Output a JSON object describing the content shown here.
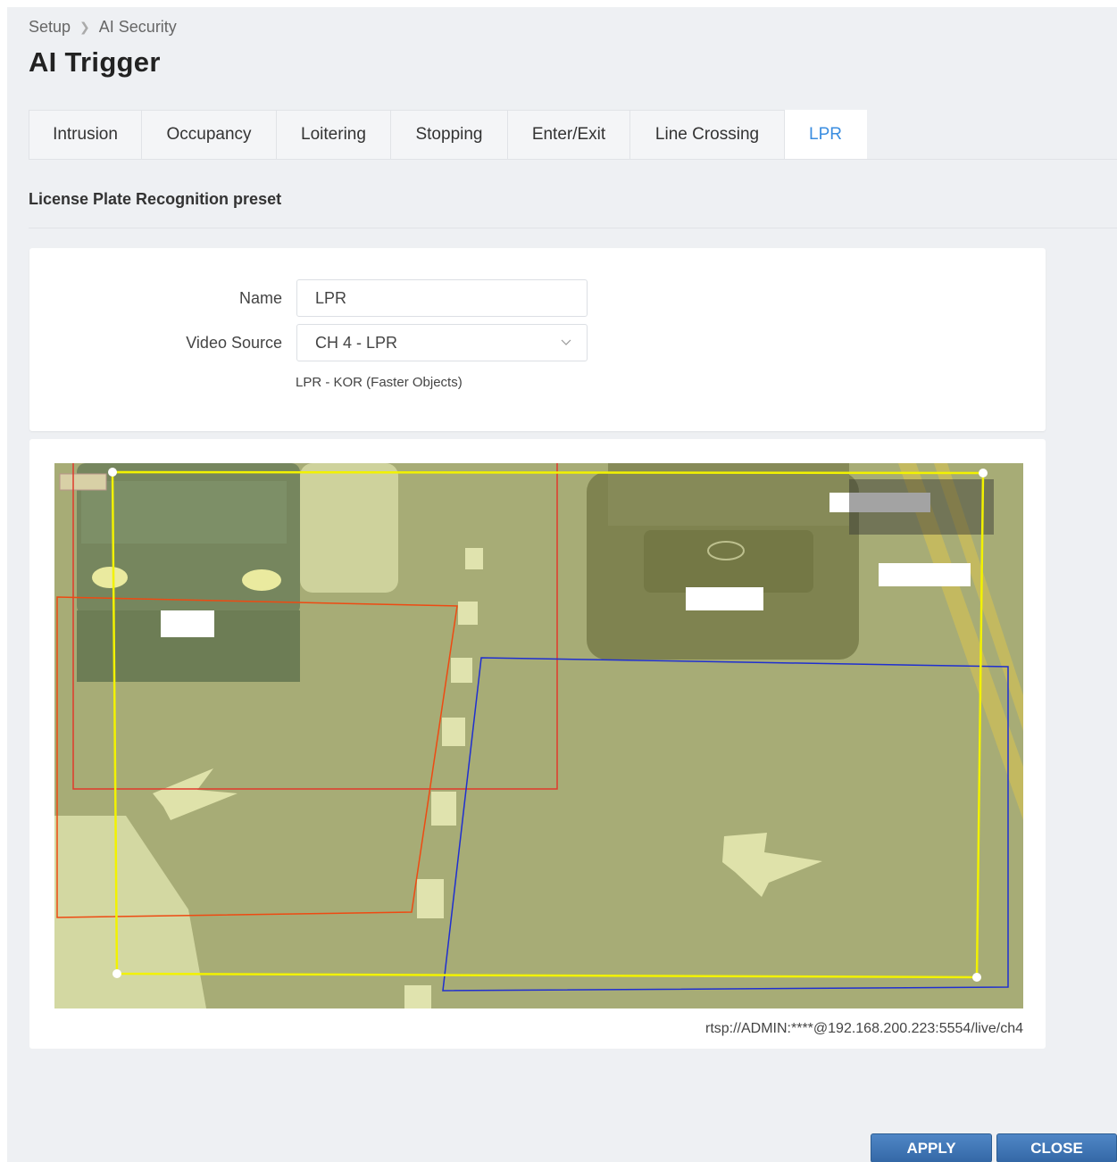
{
  "breadcrumb": {
    "root": "Setup",
    "current": "AI Security"
  },
  "page": {
    "title": "AI Trigger"
  },
  "tabs": [
    {
      "label": "Intrusion",
      "active": false
    },
    {
      "label": "Occupancy",
      "active": false
    },
    {
      "label": "Loitering",
      "active": false
    },
    {
      "label": "Stopping",
      "active": false
    },
    {
      "label": "Enter/Exit",
      "active": false
    },
    {
      "label": "Line Crossing",
      "active": false
    },
    {
      "label": "LPR",
      "active": true
    }
  ],
  "section": {
    "title": "License Plate Recognition preset"
  },
  "form": {
    "name_label": "Name",
    "name_value": "LPR",
    "video_source_label": "Video Source",
    "video_source_value": "CH 4 - LPR",
    "video_source_hint": "LPR - KOR (Faster Objects)"
  },
  "video": {
    "stream_url": "rtsp://ADMIN:****@192.168.200.223:5554/live/ch4",
    "zones": [
      {
        "name": "yellow-zone",
        "color": "#f2f200"
      },
      {
        "name": "red-zone-1",
        "color": "#e03a2c"
      },
      {
        "name": "red-zone-2",
        "color": "#ee4a12"
      },
      {
        "name": "blue-zone",
        "color": "#1f2fd0"
      }
    ]
  },
  "buttons": {
    "apply": "APPLY",
    "close": "CLOSE"
  },
  "colors": {
    "accent": "#3a8de0",
    "button": "#3d74b5",
    "background": "#eef0f3"
  }
}
